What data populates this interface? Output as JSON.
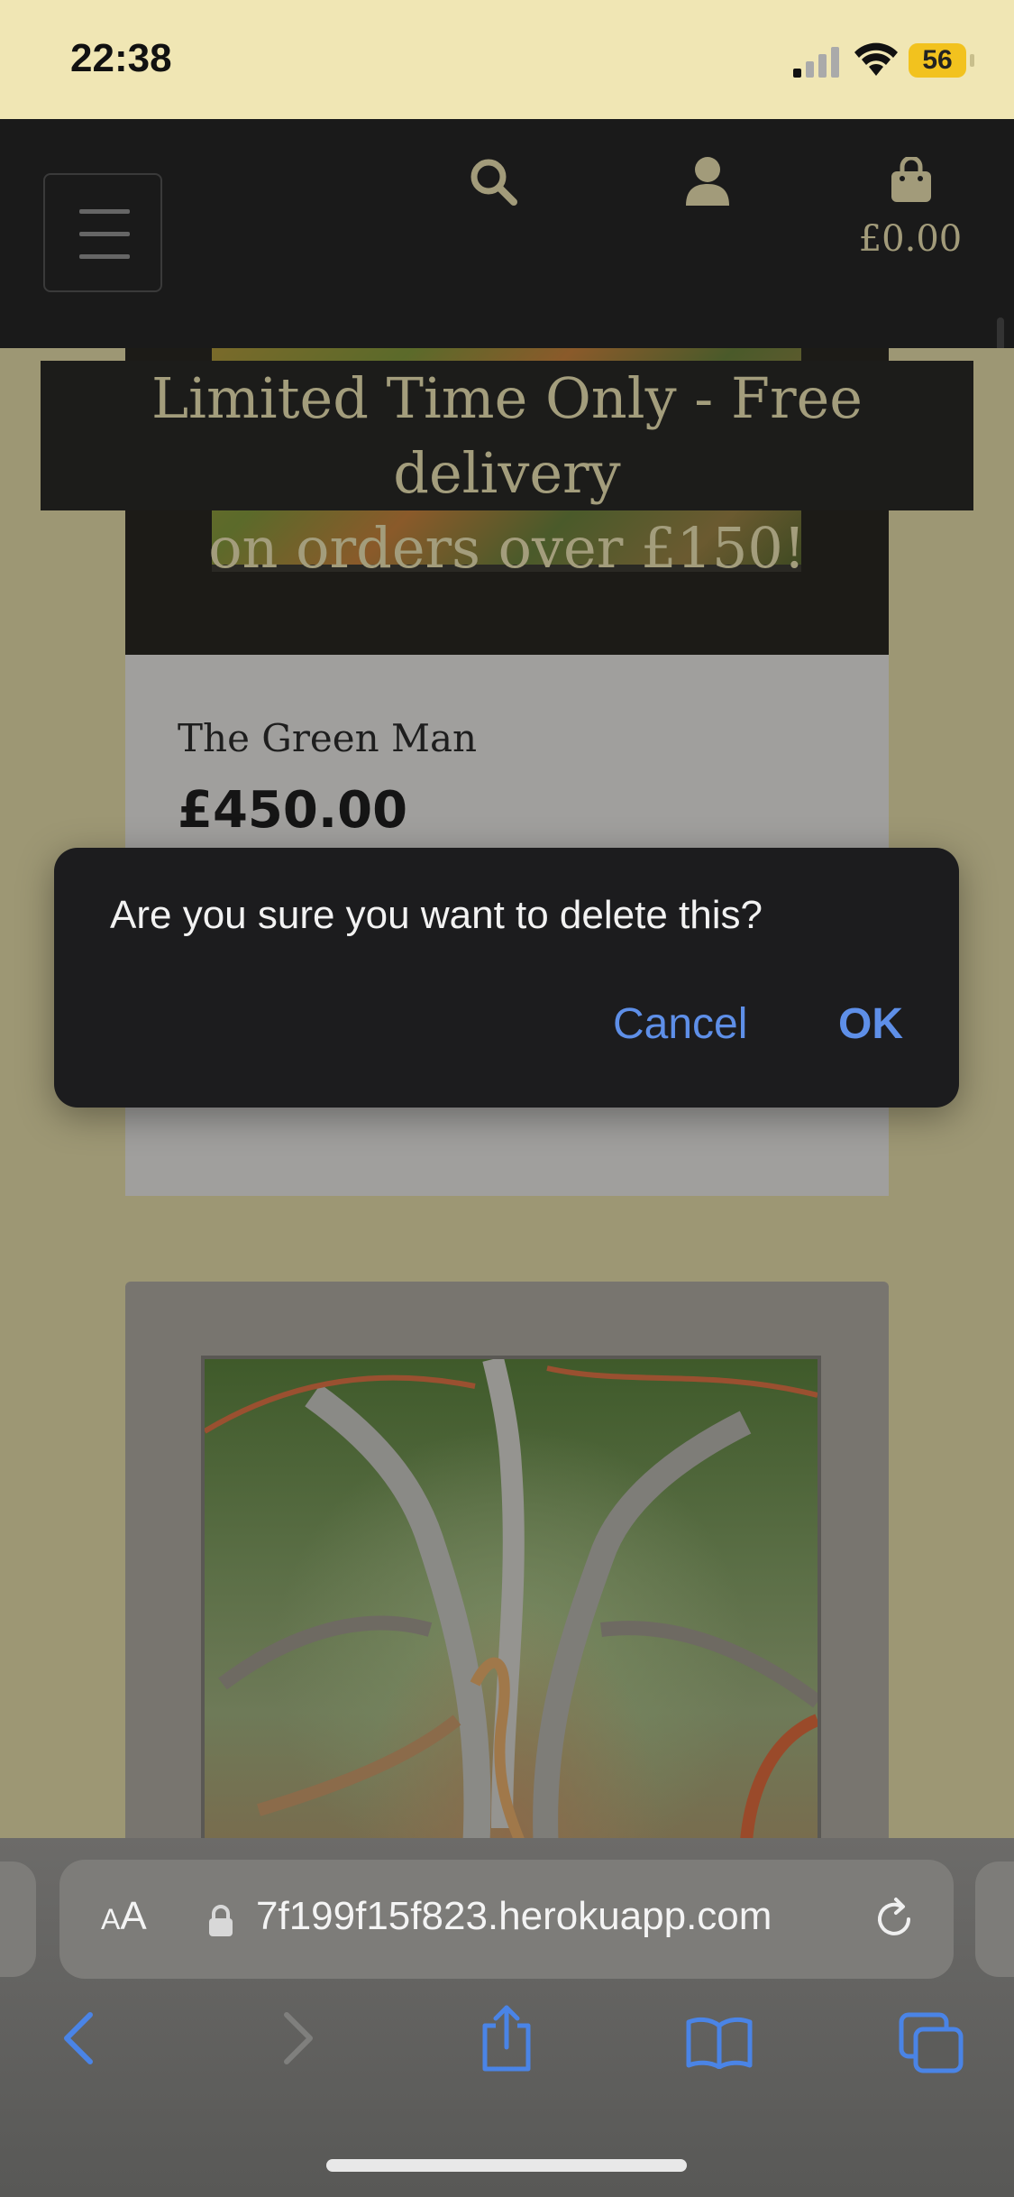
{
  "status_bar": {
    "time": "22:38",
    "battery": "56",
    "icons": [
      "cellular-signal-icon",
      "wifi-icon",
      "battery-icon"
    ]
  },
  "navbar": {
    "icons": [
      "menu-icon",
      "search-icon",
      "account-icon",
      "shopping-bag-icon"
    ],
    "cart_total": "£0.00"
  },
  "banner": {
    "line1": "Limited Time Only - Free delivery",
    "line2": "on orders over £150!"
  },
  "products": [
    {
      "title": "The Green Man",
      "price": "£450.00"
    }
  ],
  "dialog": {
    "message": "Are you sure you want to delete this?",
    "cancel_label": "Cancel",
    "ok_label": "OK"
  },
  "safari": {
    "text_size_label_small": "A",
    "text_size_label_large": "A",
    "url": "7f199f15f823.herokuapp.com",
    "toolbar_icons": [
      "back-icon",
      "forward-icon",
      "share-icon",
      "bookmarks-icon",
      "tabs-icon"
    ]
  },
  "colors": {
    "status_bar_bg": "#f0e6b4",
    "navbar_bg": "#1a1a1a",
    "accent_gold": "#a39d7c",
    "dialog_button_blue": "#5e8fe8"
  }
}
